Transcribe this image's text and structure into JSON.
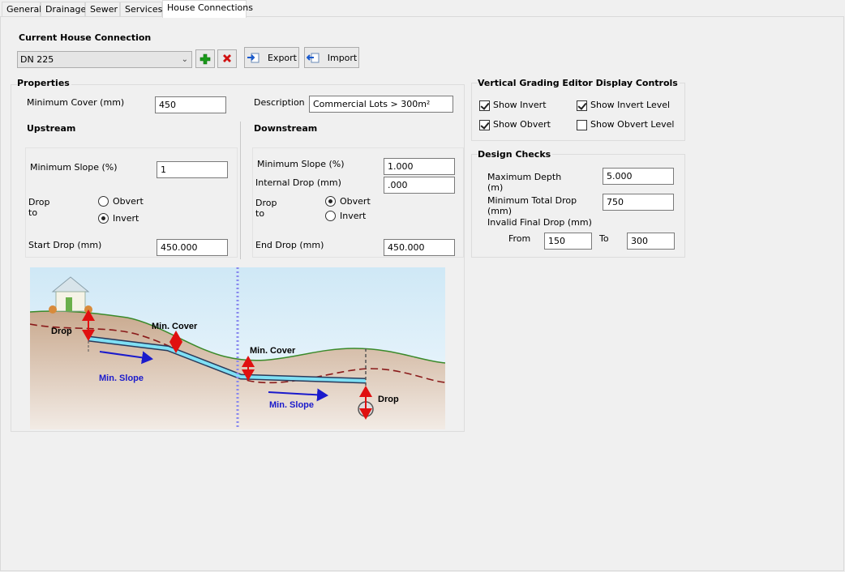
{
  "tabs": [
    "General",
    "Drainage",
    "Sewer",
    "Services",
    "House Connections"
  ],
  "active_tab": "House Connections",
  "current": {
    "title": "Current House Connection",
    "selected": "DN 225",
    "export_label": "Export",
    "import_label": "Import"
  },
  "properties": {
    "title": "Properties",
    "min_cover_label": "Minimum Cover (mm)",
    "min_cover_value": "450",
    "description_label": "Description",
    "description_value": "Commercial Lots > 300m²"
  },
  "upstream": {
    "title": "Upstream",
    "min_slope_label": "Minimum Slope (%)",
    "min_slope_value": "1",
    "drop_to_label_1": "Drop",
    "drop_to_label_2": "to",
    "obvert_label": "Obvert",
    "invert_label": "Invert",
    "selected": "Invert",
    "start_drop_label": "Start Drop (mm)",
    "start_drop_value": "450.000"
  },
  "downstream": {
    "title": "Downstream",
    "min_slope_label": "Minimum Slope (%)",
    "min_slope_value": "1.000",
    "internal_drop_label": "Internal Drop (mm)",
    "internal_drop_value": ".000",
    "drop_to_label_1": "Drop",
    "drop_to_label_2": "to",
    "obvert_label": "Obvert",
    "invert_label": "Invert",
    "selected": "Obvert",
    "end_drop_label": "End Drop (mm)",
    "end_drop_value": "450.000"
  },
  "diagram": {
    "drop_left": "Drop",
    "min_cover_1": "Min. Cover",
    "min_cover_2": "Min. Cover",
    "min_slope_1": "Min. Slope",
    "min_slope_2": "Min. Slope",
    "drop_right": "Drop"
  },
  "display_controls": {
    "title": "Vertical Grading Editor Display Controls",
    "show_invert": "Show Invert",
    "show_invert_checked": true,
    "show_invert_level": "Show Invert Level",
    "show_invert_level_checked": true,
    "show_obvert": "Show Obvert",
    "show_obvert_checked": true,
    "show_obvert_level": "Show Obvert Level",
    "show_obvert_level_checked": false
  },
  "design_checks": {
    "title": "Design Checks",
    "max_depth_label_1": "Maximum Depth",
    "max_depth_label_2": "(m)",
    "max_depth_value": "5.000",
    "min_total_drop_label_1": "Minimum Total Drop",
    "min_total_drop_label_2": "(mm)",
    "min_total_drop_value": "750",
    "invalid_final_drop_label": "Invalid Final Drop (mm)",
    "from_label": "From",
    "from_value": "150",
    "to_label": "To",
    "to_value": "300"
  },
  "colors": {
    "add": "#1a9a1a",
    "delete": "#d01010",
    "slope_arrow": "#1a1acc",
    "drop_arrow": "#e01010",
    "ground": "#3a8a2a",
    "cover_line": "#8a1a1a"
  }
}
